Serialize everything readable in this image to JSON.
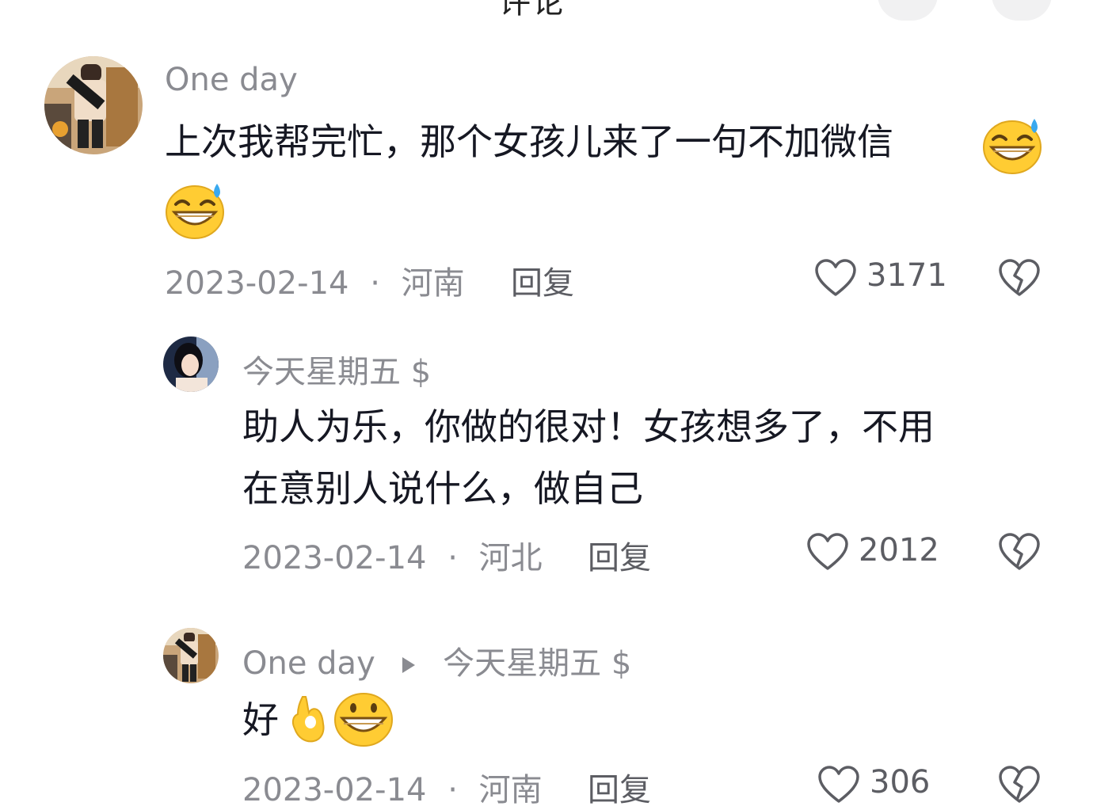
{
  "header": {
    "title": "评论",
    "left_btn": "",
    "right_btn": ""
  },
  "comments": [
    {
      "username": "One day",
      "text_line1": "上次我帮完忙，那个女孩儿来了一句不加微信",
      "date": "2023-02-14",
      "sep": "·",
      "location": "河南",
      "reply": "回复",
      "likes": "3171",
      "emoji": "sweat-smile-emoji"
    },
    {
      "username": "今天星期五 $",
      "text_line1": "助人为乐，你做的很对！女孩想多了，不用",
      "text_line2": "在意别人说什么，做自己",
      "date": "2023-02-14",
      "sep": "·",
      "location": "河北",
      "reply": "回复",
      "likes": "2012"
    },
    {
      "username": "One day",
      "reply_to": "今天星期五 $",
      "text": "好",
      "date": "2023-02-14",
      "sep": "·",
      "location": "河南",
      "reply": "回复",
      "likes": "306",
      "emoji": [
        "ok-hand-emoji",
        "grin-emoji"
      ]
    }
  ],
  "colors": {
    "text": "#161823",
    "muted": "#8a8b91",
    "secondary": "#5c5d63",
    "emoji_yellow": "#ffcc33"
  }
}
